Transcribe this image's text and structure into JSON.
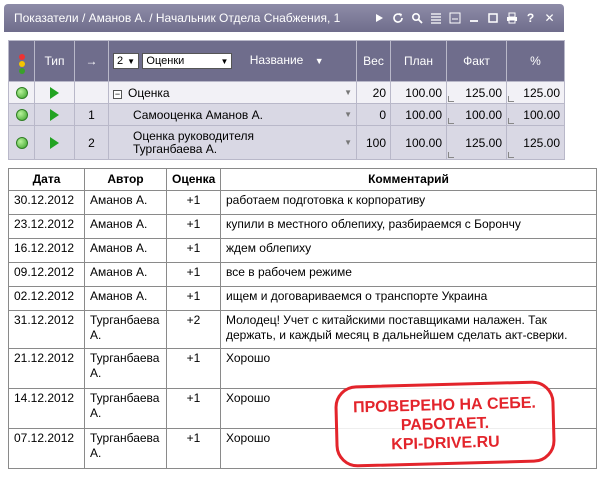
{
  "window": {
    "title": "Показатели / Аманов А. / Начальник Отдела Снабжения, 1"
  },
  "kpi": {
    "headers": {
      "type": "Тип",
      "arrow": "→",
      "level": "2",
      "filter": "Оценки",
      "name": "Название",
      "weight": "Вес",
      "plan": "План",
      "fact": "Факт",
      "percent": "%"
    },
    "rows": [
      {
        "num": "",
        "name": "Оценка",
        "weight": "20",
        "plan": "100.00",
        "fact": "125.00",
        "percent": "125.00"
      },
      {
        "num": "1",
        "name": "Самооценка Аманов А.",
        "weight": "0",
        "plan": "100.00",
        "fact": "100.00",
        "percent": "100.00"
      },
      {
        "num": "2",
        "name": "Оценка руководителя Турганбаева А.",
        "weight": "100",
        "plan": "100.00",
        "fact": "125.00",
        "percent": "125.00"
      }
    ]
  },
  "comments": {
    "headers": {
      "date": "Дата",
      "author": "Автор",
      "score": "Оценка",
      "comment": "Комментарий"
    },
    "rows": [
      {
        "date": "30.12.2012",
        "author": "Аманов А.",
        "score": "+1",
        "comment": "работаем  подготовка к корпоративу"
      },
      {
        "date": "23.12.2012",
        "author": "Аманов А.",
        "score": "+1",
        "comment": "купили в местного облепиху, разбираемся с Борончу"
      },
      {
        "date": "16.12.2012",
        "author": "Аманов А.",
        "score": "+1",
        "comment": "ждем облепиху"
      },
      {
        "date": "09.12.2012",
        "author": "Аманов А.",
        "score": "+1",
        "comment": " все в рабочем режиме"
      },
      {
        "date": "02.12.2012",
        "author": "Аманов А.",
        "score": "+1",
        "comment": "ищем и договариваемся о транспорте Украина"
      },
      {
        "date": "31.12.2012",
        "author": "Турганбаева А.",
        "score": "+2",
        "comment": "Молодец! Учет с китайскими поставщиками налажен. Так держать,  и каждый месяц в дальнейшем сделать акт-сверки."
      },
      {
        "date": "21.12.2012",
        "author": "Турганбаева А.",
        "score": "+1",
        "comment": "Хорошо"
      },
      {
        "date": "14.12.2012",
        "author": "Турганбаева А.",
        "score": "+1",
        "comment": "Хорошо"
      },
      {
        "date": "07.12.2012",
        "author": "Турганбаева А.",
        "score": "+1",
        "comment": "Хорошо"
      }
    ]
  },
  "stamp": {
    "line1": "ПРОВЕРЕНО НА СЕБЕ.",
    "line2": "РАБОТАЕТ.",
    "line3": "KPI-DRIVE.RU"
  },
  "colors": {
    "titlebar": "#6f6d8c",
    "row_light": "#f2f1f6",
    "row_dark": "#d9d8e4",
    "status_green": "#3aa12a",
    "stamp_red": "#e3242b"
  }
}
